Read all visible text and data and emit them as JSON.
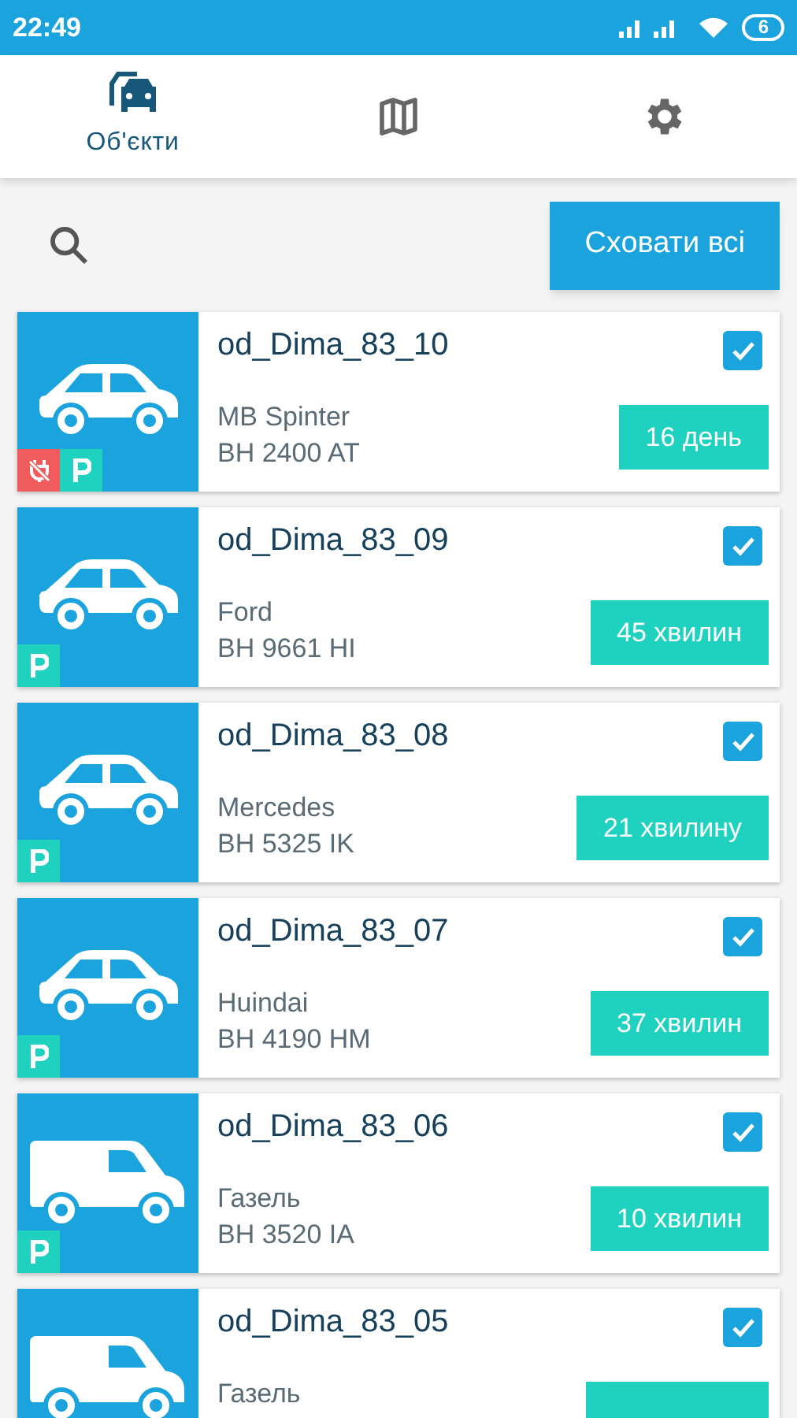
{
  "status_bar": {
    "time": "22:49",
    "battery": "6"
  },
  "tabs": [
    {
      "kind": "cars",
      "label": "Об'єкти",
      "selected": true
    },
    {
      "kind": "map",
      "selected": false
    },
    {
      "kind": "settings",
      "selected": false
    }
  ],
  "toolbar": {
    "hide_all_button": "Сховати всі"
  },
  "objects": [
    {
      "kind": "car",
      "name": "od_Dima_83_10",
      "model": "MB Spinter",
      "plate": "BH 2400 AT",
      "time": "16 день",
      "checked": true,
      "indicators": [
        {
          "kind": "unplugged"
        },
        {
          "kind": "parking"
        }
      ]
    },
    {
      "kind": "car",
      "name": "od_Dima_83_09",
      "model": "Ford",
      "plate": "BH 9661 HI",
      "time": "45 хвилин",
      "checked": true,
      "indicators": [
        {
          "kind": "parking"
        }
      ]
    },
    {
      "kind": "car",
      "name": "od_Dima_83_08",
      "model": "Mercedes",
      "plate": "BH 5325 IK",
      "time": "21 хвилину",
      "checked": true,
      "indicators": [
        {
          "kind": "parking"
        }
      ]
    },
    {
      "kind": "car",
      "name": "od_Dima_83_07",
      "model": "Huindai",
      "plate": "BH 4190 HM",
      "time": "37 хвилин",
      "checked": true,
      "indicators": [
        {
          "kind": "parking"
        }
      ]
    },
    {
      "kind": "van",
      "name": "od_Dima_83_06",
      "model": "Газель",
      "plate": "BH 3520 IA",
      "time": "10 хвилин",
      "checked": true,
      "indicators": [
        {
          "kind": "parking"
        }
      ]
    },
    {
      "kind": "van",
      "name": "od_Dima_83_05",
      "model": "Газель",
      "checked": true
    }
  ]
}
